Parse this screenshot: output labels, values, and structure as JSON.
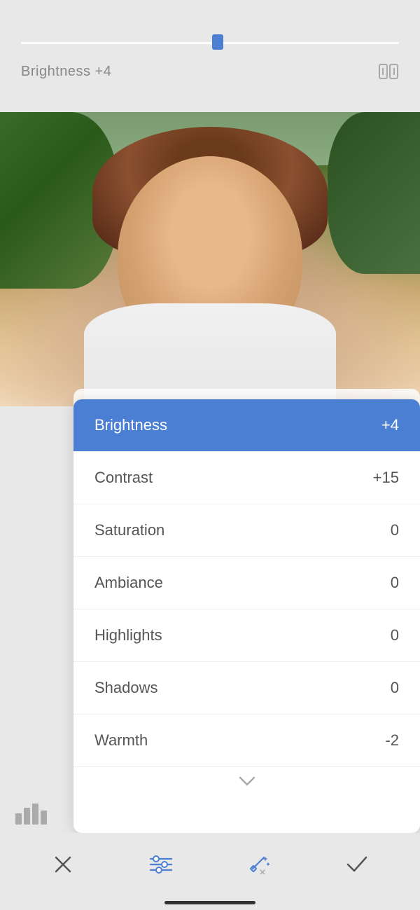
{
  "slider": {
    "label": "Brightness +4",
    "value": 4,
    "compare_label": "compare"
  },
  "menu": {
    "items": [
      {
        "id": "brightness",
        "label": "Brightness",
        "value": "+4",
        "active": true
      },
      {
        "id": "contrast",
        "label": "Contrast",
        "value": "+15",
        "active": false
      },
      {
        "id": "saturation",
        "label": "Saturation",
        "value": "0",
        "active": false
      },
      {
        "id": "ambiance",
        "label": "Ambiance",
        "value": "0",
        "active": false
      },
      {
        "id": "highlights",
        "label": "Highlights",
        "value": "0",
        "active": false
      },
      {
        "id": "shadows",
        "label": "Shadows",
        "value": "0",
        "active": false
      },
      {
        "id": "warmth",
        "label": "Warmth",
        "value": "-2",
        "active": false
      }
    ]
  },
  "toolbar": {
    "cancel_label": "✕",
    "adjust_label": "adjust",
    "auto_label": "auto",
    "confirm_label": "✓"
  }
}
